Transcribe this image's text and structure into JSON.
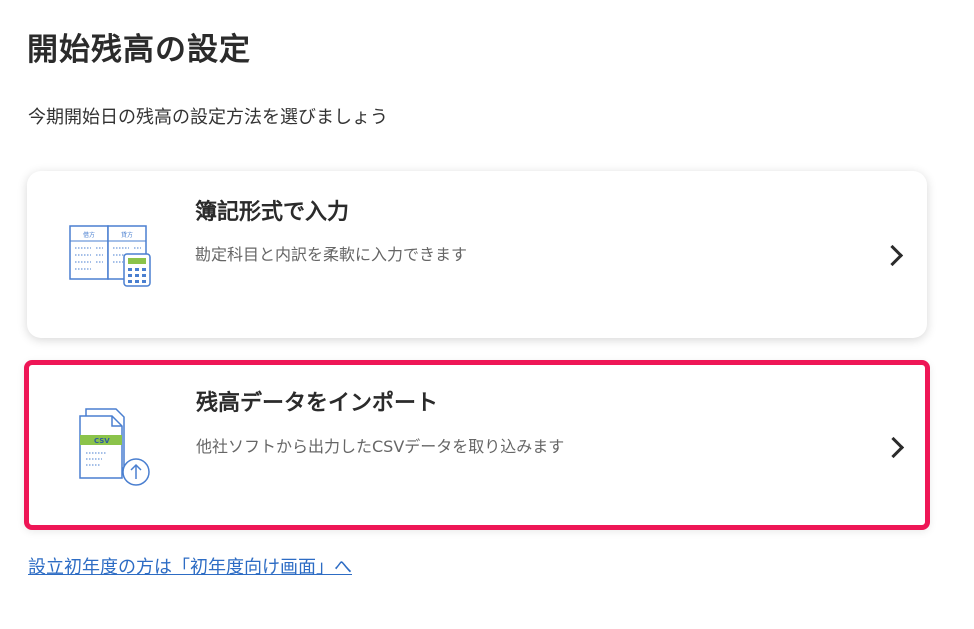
{
  "page": {
    "title": "開始残高の設定",
    "subtitle": "今期開始日の残高の設定方法を選びましょう"
  },
  "options": [
    {
      "title": "簿記形式で入力",
      "description": "勘定科目と内訳を柔軟に入力できます",
      "icon": "ledger-calculator-icon",
      "icon_labels": [
        "借方",
        "貸方"
      ]
    },
    {
      "title": "残高データをインポート",
      "description": "他社ソフトから出力したCSVデータを取り込みます",
      "icon": "csv-upload-icon",
      "icon_label": "CSV",
      "highlighted": true
    }
  ],
  "footer": {
    "link": "設立初年度の方は「初年度向け画面」へ"
  },
  "colors": {
    "highlight_border": "#ee1656",
    "link": "#2d6cc4",
    "icon_blue": "#4a7fd0",
    "icon_green": "#8bc34a"
  }
}
